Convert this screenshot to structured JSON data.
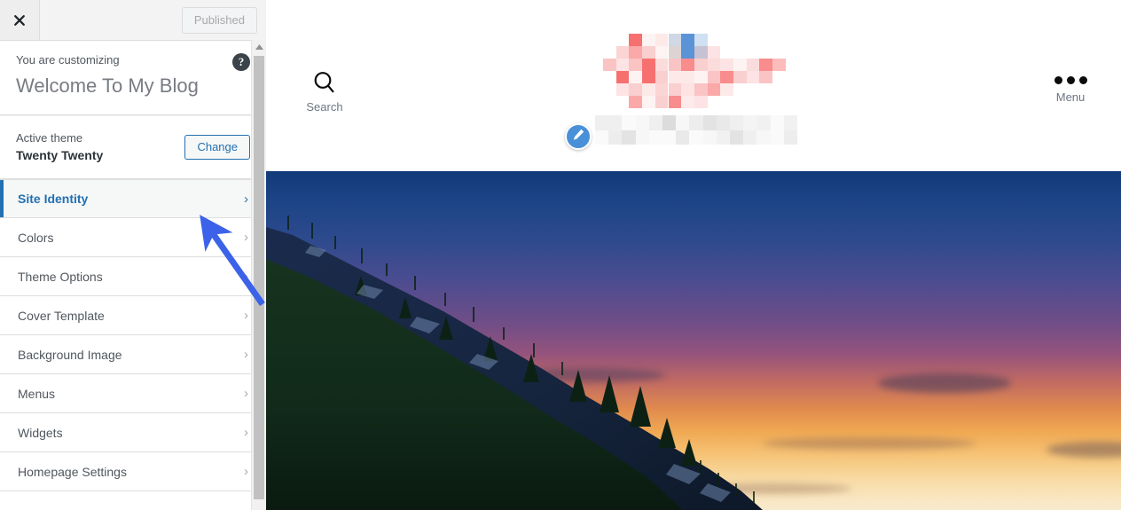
{
  "customizer": {
    "topbar": {
      "close_icon": "close-icon",
      "publish_label": "Published"
    },
    "header": {
      "customizing_label": "You are customizing",
      "site_title": "Welcome To My Blog",
      "help_icon": "?"
    },
    "theme": {
      "active_label": "Active theme",
      "name": "Twenty Twenty",
      "change_label": "Change"
    },
    "sections": [
      {
        "label": "Site Identity",
        "active": true
      },
      {
        "label": "Colors",
        "active": false
      },
      {
        "label": "Theme Options",
        "active": false
      },
      {
        "label": "Cover Template",
        "active": false
      },
      {
        "label": "Background Image",
        "active": false
      },
      {
        "label": "Menus",
        "active": false
      },
      {
        "label": "Widgets",
        "active": false
      },
      {
        "label": "Homepage Settings",
        "active": false
      }
    ],
    "chevron": "›"
  },
  "preview": {
    "search_label": "Search",
    "menu_label": "Menu",
    "site_title_redacted": "[pixelated site title]",
    "tagline_redacted": "[pixelated site tagline]",
    "edit_icon": "pencil-icon"
  },
  "colors": {
    "accent_blue": "#2271b1",
    "arrow_blue": "#3b62e8",
    "sidebar_bg": "#ffffff",
    "topbar_bg": "#eeeeee",
    "scrollbar_thumb": "#c1c1c1",
    "edit_badge": "#4a90d9",
    "dot_black": "#0b0b0b"
  }
}
